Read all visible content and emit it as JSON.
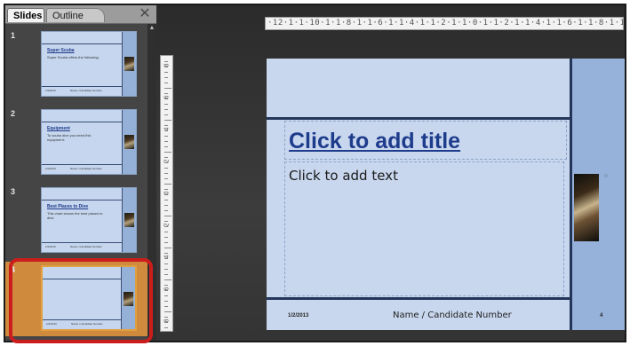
{
  "tabs": {
    "slides": "Slides",
    "outline": "Outline"
  },
  "panel_close_glyph": "✕",
  "thumbnails": [
    {
      "number": "1",
      "title": "Super Scuba",
      "text": "Super Scuba offers the following:",
      "date": "1/2/2013",
      "name": "Name / Candidate Number",
      "num": "1"
    },
    {
      "number": "2",
      "title": "Equipment",
      "text": "To scuba dive you need this equipment:",
      "date": "1/2/2013",
      "name": "Name / Candidate Number",
      "num": "2"
    },
    {
      "number": "3",
      "title": "Best Places to Dive",
      "text": "This chart shows the best places to dive:",
      "date": "1/2/2013",
      "name": "Name / Candidate Number",
      "num": "3"
    },
    {
      "number": "4",
      "title": "",
      "text": "",
      "date": "1/2/2013",
      "name": "Name / Candidate Number",
      "num": "4"
    }
  ],
  "ruler": {
    "horizontal": "·12·1·1·10·1·1·8·1·1·6·1·1·4·1·1·2·1·1·0·1·1·2·1·1·4·1·1·6·1·1·8·1·1·10·1·1·12·",
    "vertical_labels": [
      "8",
      "6",
      "4",
      "2",
      "0",
      "2",
      "4",
      "6",
      "8"
    ]
  },
  "slide": {
    "title_placeholder": "Click to add title",
    "body_placeholder": "Click to add text",
    "footer_date": "1/2/2013",
    "footer_name": "Name / Candidate Number",
    "footer_number": "4"
  },
  "colors": {
    "slide_background": "#c8d7ee",
    "slide_accent": "#233659",
    "title": "#1e3c8c",
    "highlight": "#cc1d1d",
    "selected_slide": "#d08a3e"
  }
}
